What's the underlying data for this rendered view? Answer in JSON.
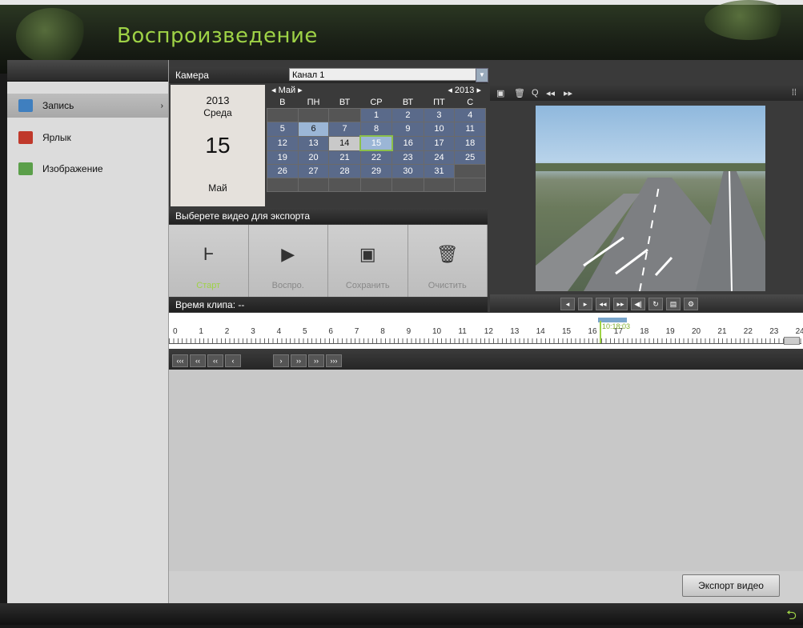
{
  "header": {
    "title": "Воспроизведение"
  },
  "sidebar": {
    "items": [
      {
        "label": "Запись",
        "icon": "record-icon",
        "arrow": "›",
        "active": true
      },
      {
        "label": "Ярлык",
        "icon": "tag-icon"
      },
      {
        "label": "Изображение",
        "icon": "image-icon"
      }
    ]
  },
  "camera": {
    "label": "Камера",
    "value": "Канал 1",
    "dropdown_glyph": "▼"
  },
  "day": {
    "year": "2013",
    "weekday": "Среда",
    "day": "15",
    "month": "Май"
  },
  "calendar": {
    "month": "◂ Май ▸",
    "year": "◂ 2013 ▸",
    "headers": [
      "В",
      "ПН",
      "ВТ",
      "СР",
      "ВТ",
      "ПТ",
      "С"
    ],
    "rows": [
      [
        "",
        "",
        "",
        "1",
        "2",
        "3",
        "4"
      ],
      [
        "5",
        "6",
        "7",
        "8",
        "9",
        "10",
        "11"
      ],
      [
        "12",
        "13",
        "14",
        "15",
        "16",
        "17",
        "18"
      ],
      [
        "19",
        "20",
        "21",
        "22",
        "23",
        "24",
        "25"
      ],
      [
        "26",
        "27",
        "28",
        "29",
        "30",
        "31",
        ""
      ],
      [
        "",
        "",
        "",
        "",
        "",
        "",
        ""
      ]
    ]
  },
  "export": {
    "header": "Выберете видео для экспорта",
    "buttons": [
      {
        "label": "Старт",
        "icon": "start-bracket-icon",
        "glyph": "Ⱶ"
      },
      {
        "label": "Воспро.",
        "icon": "play-icon",
        "glyph": "▶"
      },
      {
        "label": "Сохранить",
        "icon": "save-icon",
        "glyph": "▣"
      },
      {
        "label": "Очистить",
        "icon": "trash-icon",
        "glyph": "🗑"
      }
    ],
    "clip_time": "Время клипа: --",
    "export_button": "Экспорт видео"
  },
  "timeline": {
    "labels": [
      "0",
      "1",
      "2",
      "3",
      "4",
      "5",
      "6",
      "7",
      "8",
      "9",
      "10",
      "11",
      "12",
      "13",
      "14",
      "15",
      "16",
      "17",
      "18",
      "19",
      "20",
      "21",
      "22",
      "23",
      "24"
    ],
    "current_time": "10:18:03"
  },
  "nav_buttons": [
    "‹‹‹",
    "‹‹",
    "‹‹",
    "‹",
    "›",
    "››",
    "››",
    "›››"
  ],
  "video_toolbar": [
    "▣",
    "🗑",
    "Q",
    "◂◂",
    "▸▸",
    "⁞⁞"
  ],
  "video_controls": [
    "◂",
    "▸",
    "◂◂",
    "▸▸",
    "◀|",
    "↻",
    "▤",
    "⚙"
  ],
  "footer": {
    "return_glyph": "⮌"
  }
}
